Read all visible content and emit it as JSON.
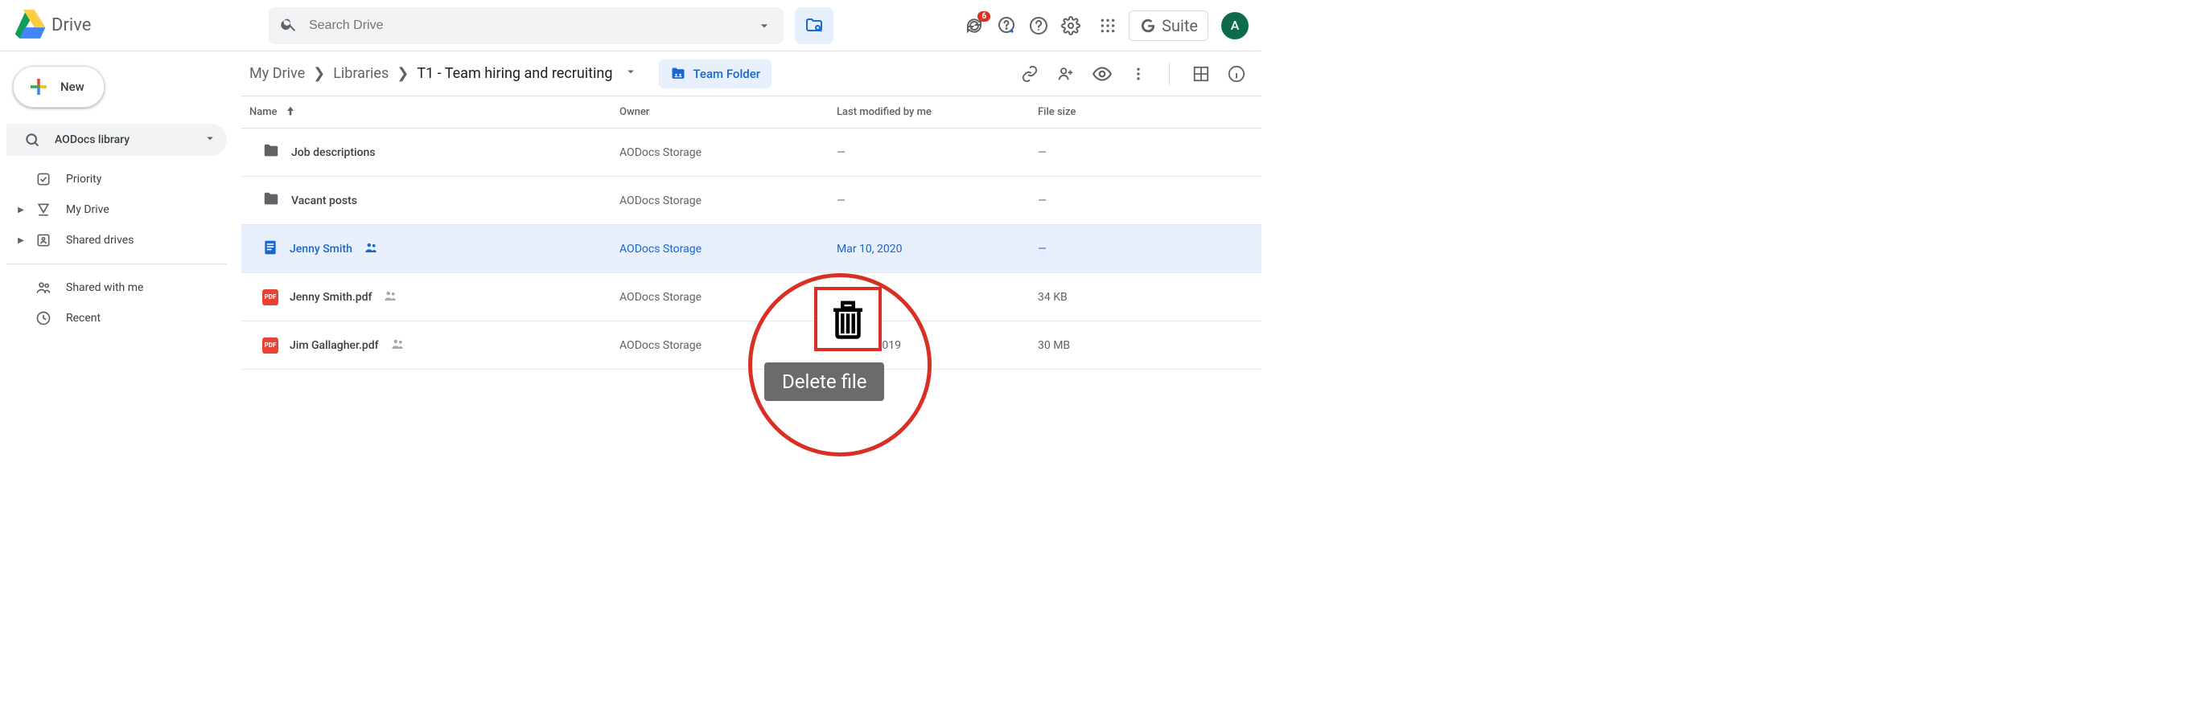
{
  "header": {
    "product": "Drive",
    "searchPlaceholder": "Search Drive",
    "offlineBadge": "6",
    "suiteLabel": "Suite",
    "avatarLetter": "A"
  },
  "sidebar": {
    "newLabel": "New",
    "aodocsLabel": "AODocs library",
    "items": [
      {
        "label": "Priority"
      },
      {
        "label": "My Drive"
      },
      {
        "label": "Shared drives"
      }
    ],
    "secondary": [
      {
        "label": "Shared with me"
      },
      {
        "label": "Recent"
      }
    ]
  },
  "toolbar": {
    "crumbs": [
      "My Drive",
      "Libraries",
      "T1 - Team hiring and recruiting"
    ],
    "teamFolderChip": "Team Folder"
  },
  "columns": {
    "name": "Name",
    "owner": "Owner",
    "modified": "Last modified by me",
    "size": "File size"
  },
  "rows": [
    {
      "type": "folder",
      "name": "Job descriptions",
      "owner": "AODocs Storage",
      "modified": "—",
      "size": "—",
      "shared": false,
      "selected": false
    },
    {
      "type": "folder",
      "name": "Vacant posts",
      "owner": "AODocs Storage",
      "modified": "—",
      "size": "—",
      "shared": false,
      "selected": false
    },
    {
      "type": "doc",
      "name": "Jenny Smith",
      "owner": "AODocs Storage",
      "modified": "Mar 10, 2020",
      "size": "—",
      "shared": true,
      "selected": true
    },
    {
      "type": "pdf",
      "name": "Jenny Smith.pdf",
      "owner": "AODocs Storage",
      "modified": "—",
      "size": "34 KB",
      "shared": true,
      "selected": false
    },
    {
      "type": "pdf",
      "name": "Jim Gallagher.pdf",
      "owner": "AODocs Storage",
      "modified": "Jan 31, 2019",
      "size": "30 MB",
      "shared": true,
      "selected": false
    }
  ],
  "callout": {
    "tooltip": "Delete file"
  }
}
